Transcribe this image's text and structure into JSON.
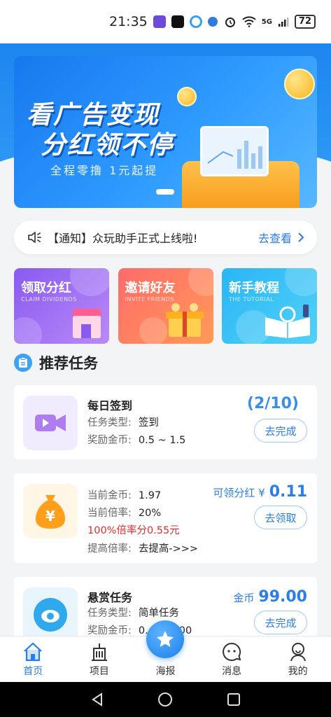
{
  "status_bar": {
    "time": "21:35",
    "battery": "72",
    "network": "5G"
  },
  "banner": {
    "line1": "看广告变现",
    "line2": "分红领不停",
    "line3": "全程零撸 1元起提"
  },
  "notice": {
    "text": "【通知】众玩助手正式上线啦!",
    "link": "去查看"
  },
  "features": [
    {
      "title": "领取分红",
      "subtitle": "CLAIM DIVIDENDS"
    },
    {
      "title": "邀请好友",
      "subtitle": "INVITE FRIENDS"
    },
    {
      "title": "新手教程",
      "subtitle": "THE TUTORIAL"
    }
  ],
  "section": {
    "title": "推荐任务"
  },
  "tasks": {
    "daily": {
      "name": "每日签到",
      "progress": "(2/10)",
      "type_label": "任务类型:",
      "type_value": "签到",
      "reward_label": "奖励金币:",
      "reward_value": "0.5 ~ 1.5",
      "button": "去完成"
    },
    "dividend": {
      "coins_label": "当前金币:",
      "coins_value": "1.97",
      "multiplier_label": "当前倍率:",
      "multiplier_value": "20%",
      "highlight": "100%倍率分0.55元",
      "raise_label": "提高倍率:",
      "raise_value": "去提高->>>",
      "claimable_label": "可领分红 ¥",
      "claimable_value": "0.11",
      "button": "去领取"
    },
    "bounty": {
      "name": "悬赏任务",
      "type_label": "任务类型:",
      "type_value": "简单任务",
      "reward_label": "奖励金币:",
      "reward_value": "0.",
      "reward_value_tail": "00",
      "coin_label": "金币",
      "coin_value": "99.00",
      "button": "去完成"
    }
  },
  "nav": {
    "home": "首页",
    "projects": "项目",
    "poster": "海报",
    "messages": "消息",
    "mine": "我的"
  },
  "colors": {
    "primary": "#2b7de9",
    "accent_red": "#e22d2d",
    "banner_blue": "#1d86f0"
  }
}
